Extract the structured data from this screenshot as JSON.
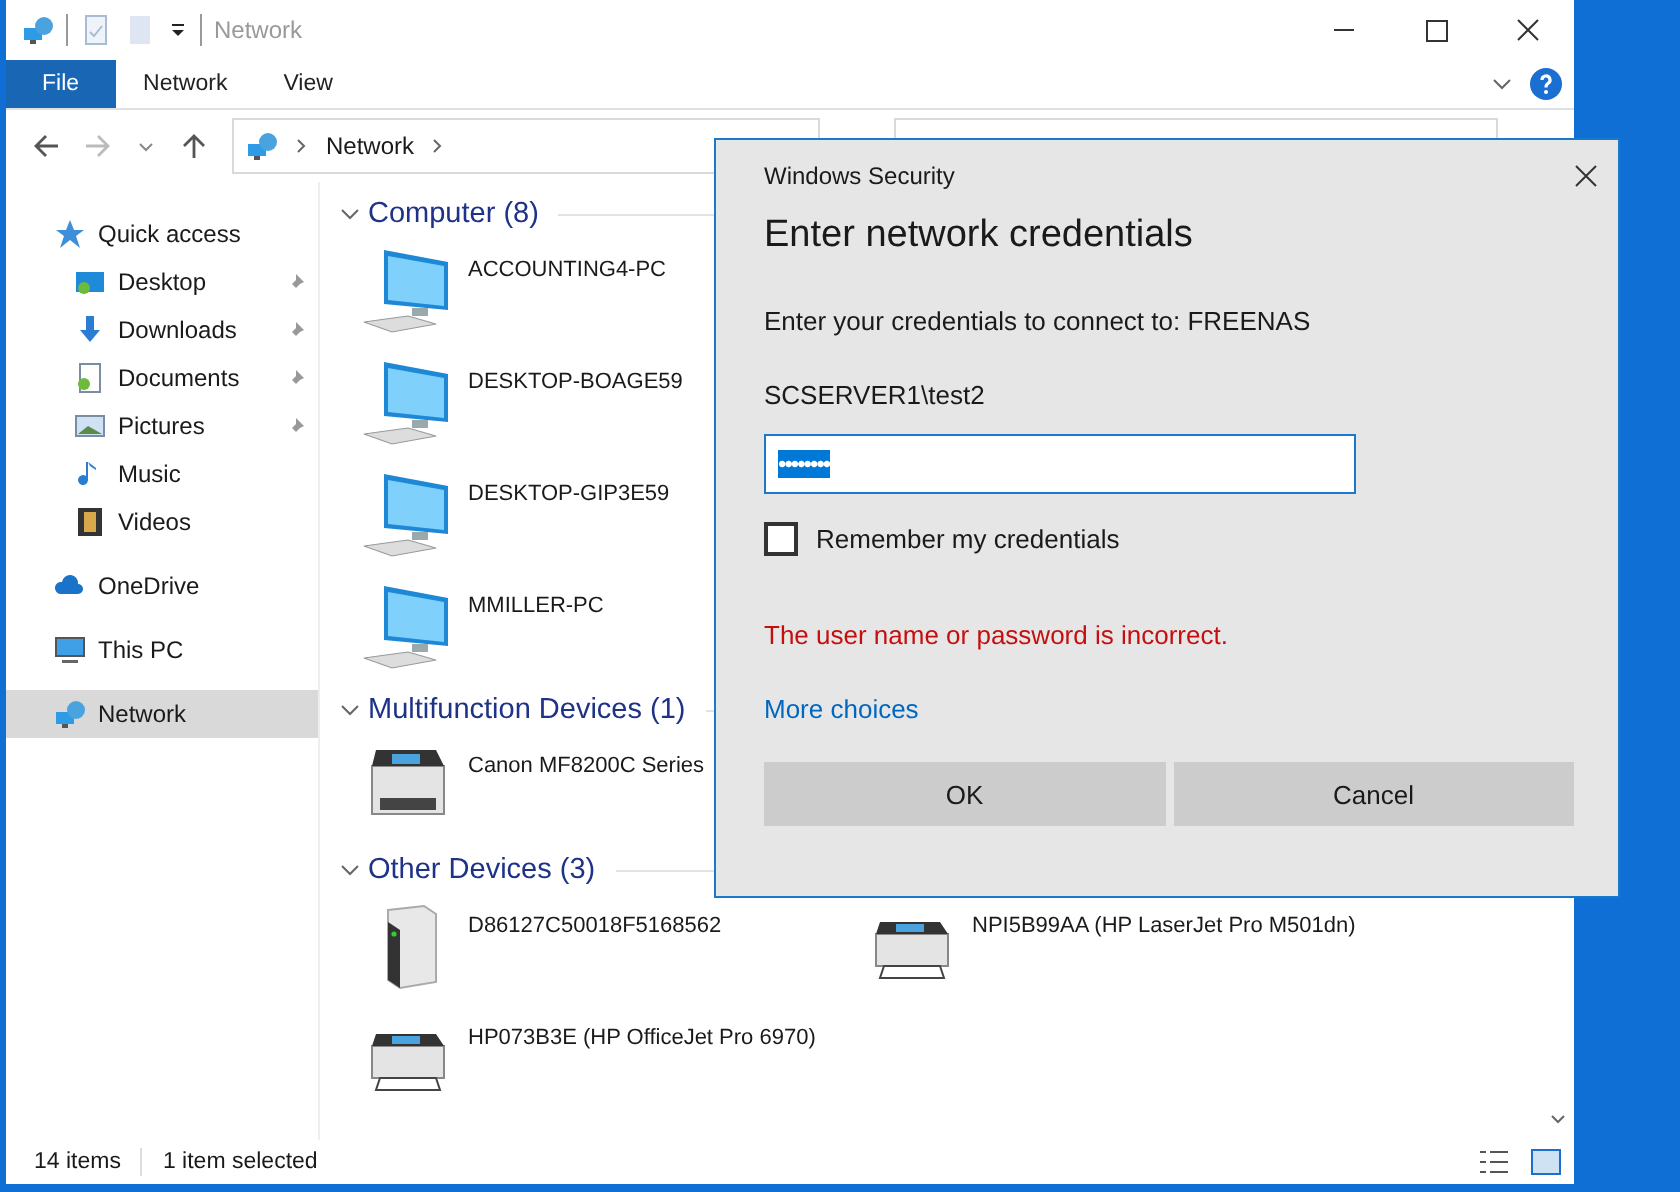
{
  "window": {
    "title": "Network"
  },
  "ribbon_tabs": [
    {
      "label": "File",
      "selected": true
    },
    {
      "label": "Network",
      "selected": false
    },
    {
      "label": "View",
      "selected": false
    }
  ],
  "address": {
    "path": [
      "Network"
    ]
  },
  "sidebar": {
    "items": [
      {
        "label": "Quick access",
        "selected": false,
        "children": [
          {
            "label": "Desktop",
            "pinned": true,
            "selected": false
          },
          {
            "label": "Downloads",
            "pinned": true,
            "selected": false
          },
          {
            "label": "Documents",
            "pinned": true,
            "selected": false
          },
          {
            "label": "Pictures",
            "pinned": true,
            "selected": false
          },
          {
            "label": "Music",
            "pinned": false,
            "selected": false
          },
          {
            "label": "Videos",
            "pinned": false,
            "selected": false
          }
        ]
      },
      {
        "label": "OneDrive",
        "selected": false
      },
      {
        "label": "This PC",
        "selected": false
      },
      {
        "label": "Network",
        "selected": true
      }
    ]
  },
  "groups": [
    {
      "title": "Computer (8)",
      "kind": "column",
      "expanded": true,
      "items": [
        {
          "name": "ACCOUNTING4-PC",
          "kind": "computer"
        },
        {
          "name": "DESKTOP-BOAGE59",
          "kind": "computer"
        },
        {
          "name": "DESKTOP-GIP3E59",
          "kind": "computer"
        },
        {
          "name": "MMILLER-PC",
          "kind": "computer"
        }
      ]
    },
    {
      "title": "Multifunction Devices (1)",
      "kind": "column",
      "expanded": true,
      "items": [
        {
          "name": "Canon MF8200C Series",
          "kind": "mfp"
        }
      ]
    },
    {
      "title": "Other Devices (3)",
      "kind": "grid",
      "expanded": true,
      "items": [
        {
          "name": "D86127C50018F5168562",
          "kind": "nas"
        },
        {
          "name": "HP073B3E (HP OfficeJet Pro 6970)",
          "kind": "printer"
        },
        {
          "name": "NPI5B99AA (HP LaserJet Pro M501dn)",
          "kind": "printer"
        }
      ]
    }
  ],
  "status_bar": {
    "count": "14 items",
    "selection": "1 item selected"
  },
  "dialog": {
    "title": "Windows Security",
    "heading": "Enter network credentials",
    "prompt": "Enter your credentials to connect to: FREENAS",
    "username": "SCSERVER1\\test2",
    "password": "••••••••",
    "remember": {
      "label": "Remember my credentials",
      "checked": false
    },
    "error": "The user name or password is incorrect.",
    "more": "More choices",
    "buttons": [
      "OK",
      "Cancel"
    ]
  }
}
